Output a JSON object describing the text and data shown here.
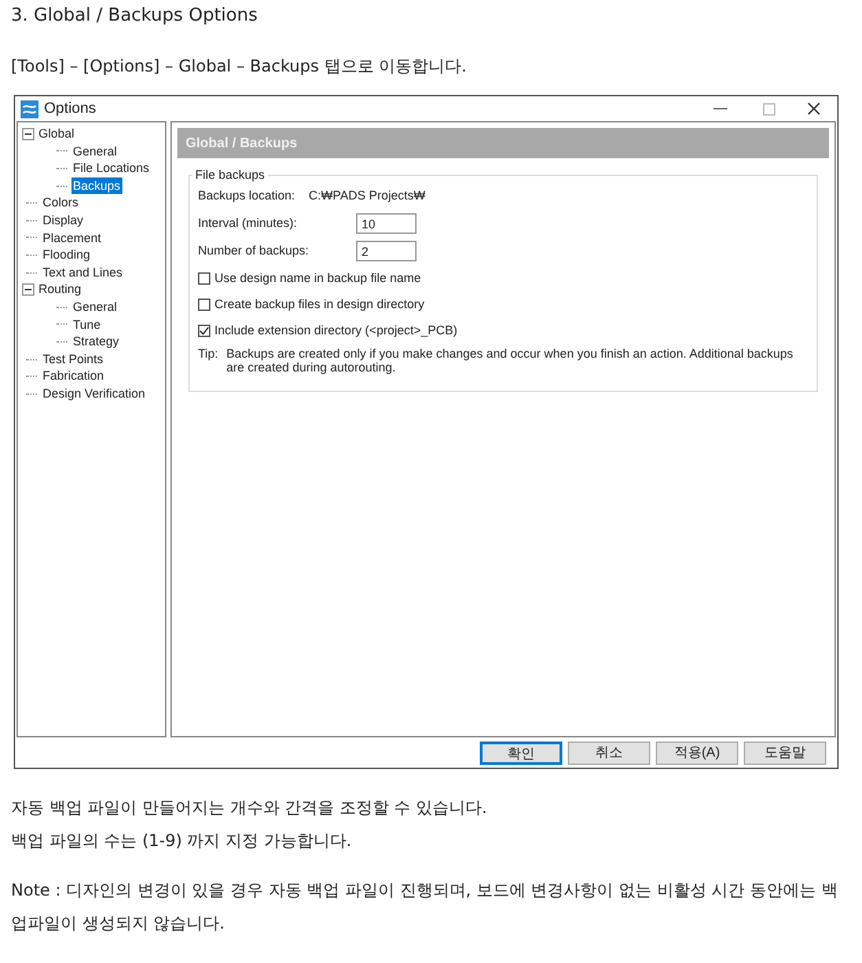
{
  "heading": "3. Global / Backups Options",
  "intro": "[Tools] – [Options] – Global – Backups 탭으로 이동합니다.",
  "window": {
    "title": "Options"
  },
  "tree": [
    {
      "label": "Global",
      "expanded": true,
      "selected": false,
      "children": [
        {
          "label": "General",
          "selected": false
        },
        {
          "label": "File Locations",
          "selected": false
        },
        {
          "label": "Backups",
          "selected": true
        }
      ]
    },
    {
      "label": "Colors",
      "selected": false
    },
    {
      "label": "Display",
      "selected": false
    },
    {
      "label": "Placement",
      "selected": false
    },
    {
      "label": "Flooding",
      "selected": false
    },
    {
      "label": "Text and Lines",
      "selected": false
    },
    {
      "label": "Routing",
      "expanded": true,
      "selected": false,
      "children": [
        {
          "label": "General",
          "selected": false
        },
        {
          "label": "Tune",
          "selected": false
        },
        {
          "label": "Strategy",
          "selected": false
        }
      ]
    },
    {
      "label": "Test Points",
      "selected": false
    },
    {
      "label": "Fabrication",
      "selected": false
    },
    {
      "label": "Design Verification",
      "selected": false
    }
  ],
  "panel": {
    "title": "Global / Backups",
    "group": "File backups",
    "location_label": "Backups location:",
    "location_value": "C:₩PADS Projects₩",
    "fields": [
      {
        "label": "Interval (minutes):",
        "value": "10"
      },
      {
        "label": "Number of backups:",
        "value": "2"
      }
    ],
    "checkboxes": [
      {
        "label": "Use design name in backup file name",
        "checked": false
      },
      {
        "label": "Create backup files in design directory",
        "checked": false
      },
      {
        "label": "Include extension directory (<project>_PCB)",
        "checked": true
      }
    ],
    "tip_label": "Tip:",
    "tip": "Backups are created only if you make changes and occur when you finish an action. Additional backups are created during autorouting."
  },
  "buttons": [
    {
      "label": "확인",
      "default": true
    },
    {
      "label": "취소",
      "default": false
    },
    {
      "label": "적용(A)",
      "default": false
    },
    {
      "label": "도움말",
      "default": false
    }
  ],
  "paragraphs": [
    "자동 백업 파일이 만들어지는 개수와 간격을 조정할 수 있습니다.",
    "백업 파일의 수는 (1-9) 까지 지정 가능합니다.",
    "Note : 디자인의 변경이 있을 경우 자동 백업 파일이 진행되며, 보드에 변경사항이 없는 비활성 시간 동안에는 백업파일이 생성되지 않습니다."
  ]
}
